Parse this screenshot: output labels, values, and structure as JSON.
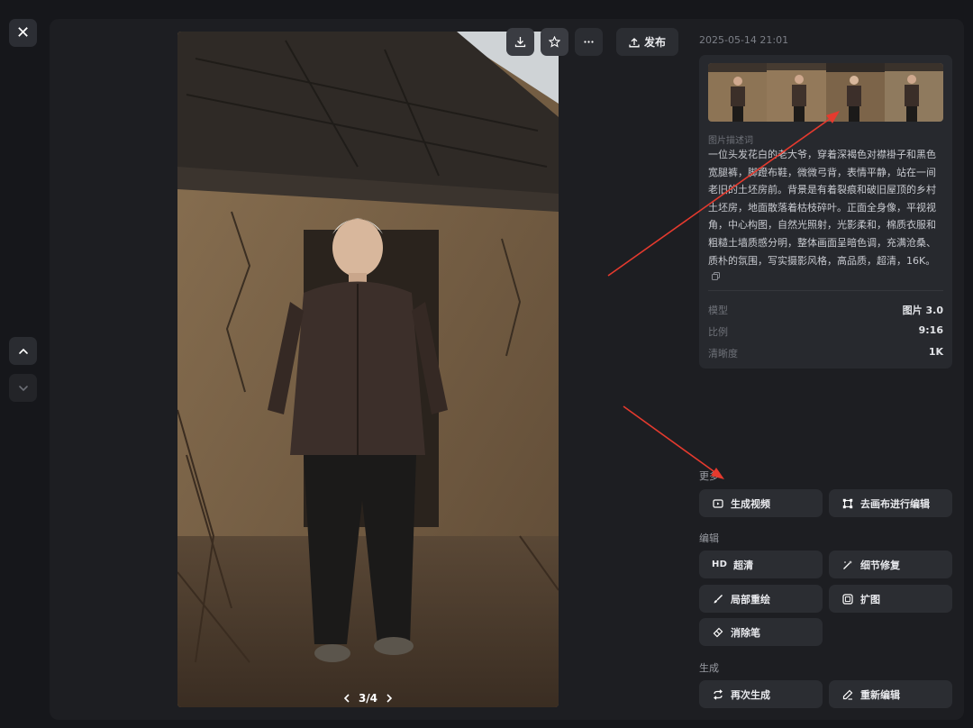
{
  "window": {
    "close_label": "✕"
  },
  "image_viewer": {
    "pager_text": "3/4",
    "publish_label": "发布"
  },
  "info": {
    "timestamp": "2025-05-14 21:01",
    "description_label": "图片描述词",
    "description": "一位头发花白的老大爷，穿着深褐色对襟褂子和黑色宽腿裤，脚蹬布鞋，微微弓背，表情平静，站在一间老旧的土坯房前。背景是有着裂痕和破旧屋顶的乡村土坯房，地面散落着枯枝碎叶。正面全身像，平视视角，中心构图，自然光照射，光影柔和，棉质衣服和粗糙土墙质感分明，整体画面呈暗色调，充满沧桑、质朴的氛围，写实摄影风格，高品质，超清，16K。",
    "meta": [
      {
        "key": "模型",
        "value": "图片 3.0"
      },
      {
        "key": "比例",
        "value": "9:16"
      },
      {
        "key": "清晰度",
        "value": "1K"
      }
    ]
  },
  "sections": {
    "more": {
      "title": "更多",
      "buttons": [
        {
          "label": "生成视频",
          "icon": "video-icon"
        },
        {
          "label": "去画布进行编辑",
          "icon": "canvas-icon"
        }
      ]
    },
    "edit": {
      "title": "编辑",
      "buttons": [
        {
          "label": "超清",
          "icon": "hd-icon",
          "icon_text": "HD"
        },
        {
          "label": "细节修复",
          "icon": "magic-wand-icon"
        },
        {
          "label": "局部重绘",
          "icon": "brush-icon"
        },
        {
          "label": "扩图",
          "icon": "expand-icon"
        },
        {
          "label": "消除笔",
          "icon": "eraser-icon"
        }
      ]
    },
    "generate": {
      "title": "生成",
      "buttons": [
        {
          "label": "再次生成",
          "icon": "regenerate-icon"
        },
        {
          "label": "重新编辑",
          "icon": "pencil-icon"
        }
      ]
    }
  },
  "colors": {
    "background": "#16171b",
    "card": "#1d1e22",
    "panel": "#27292e",
    "button": "#2b2d32",
    "annotation_arrow": "#e53a2e"
  }
}
